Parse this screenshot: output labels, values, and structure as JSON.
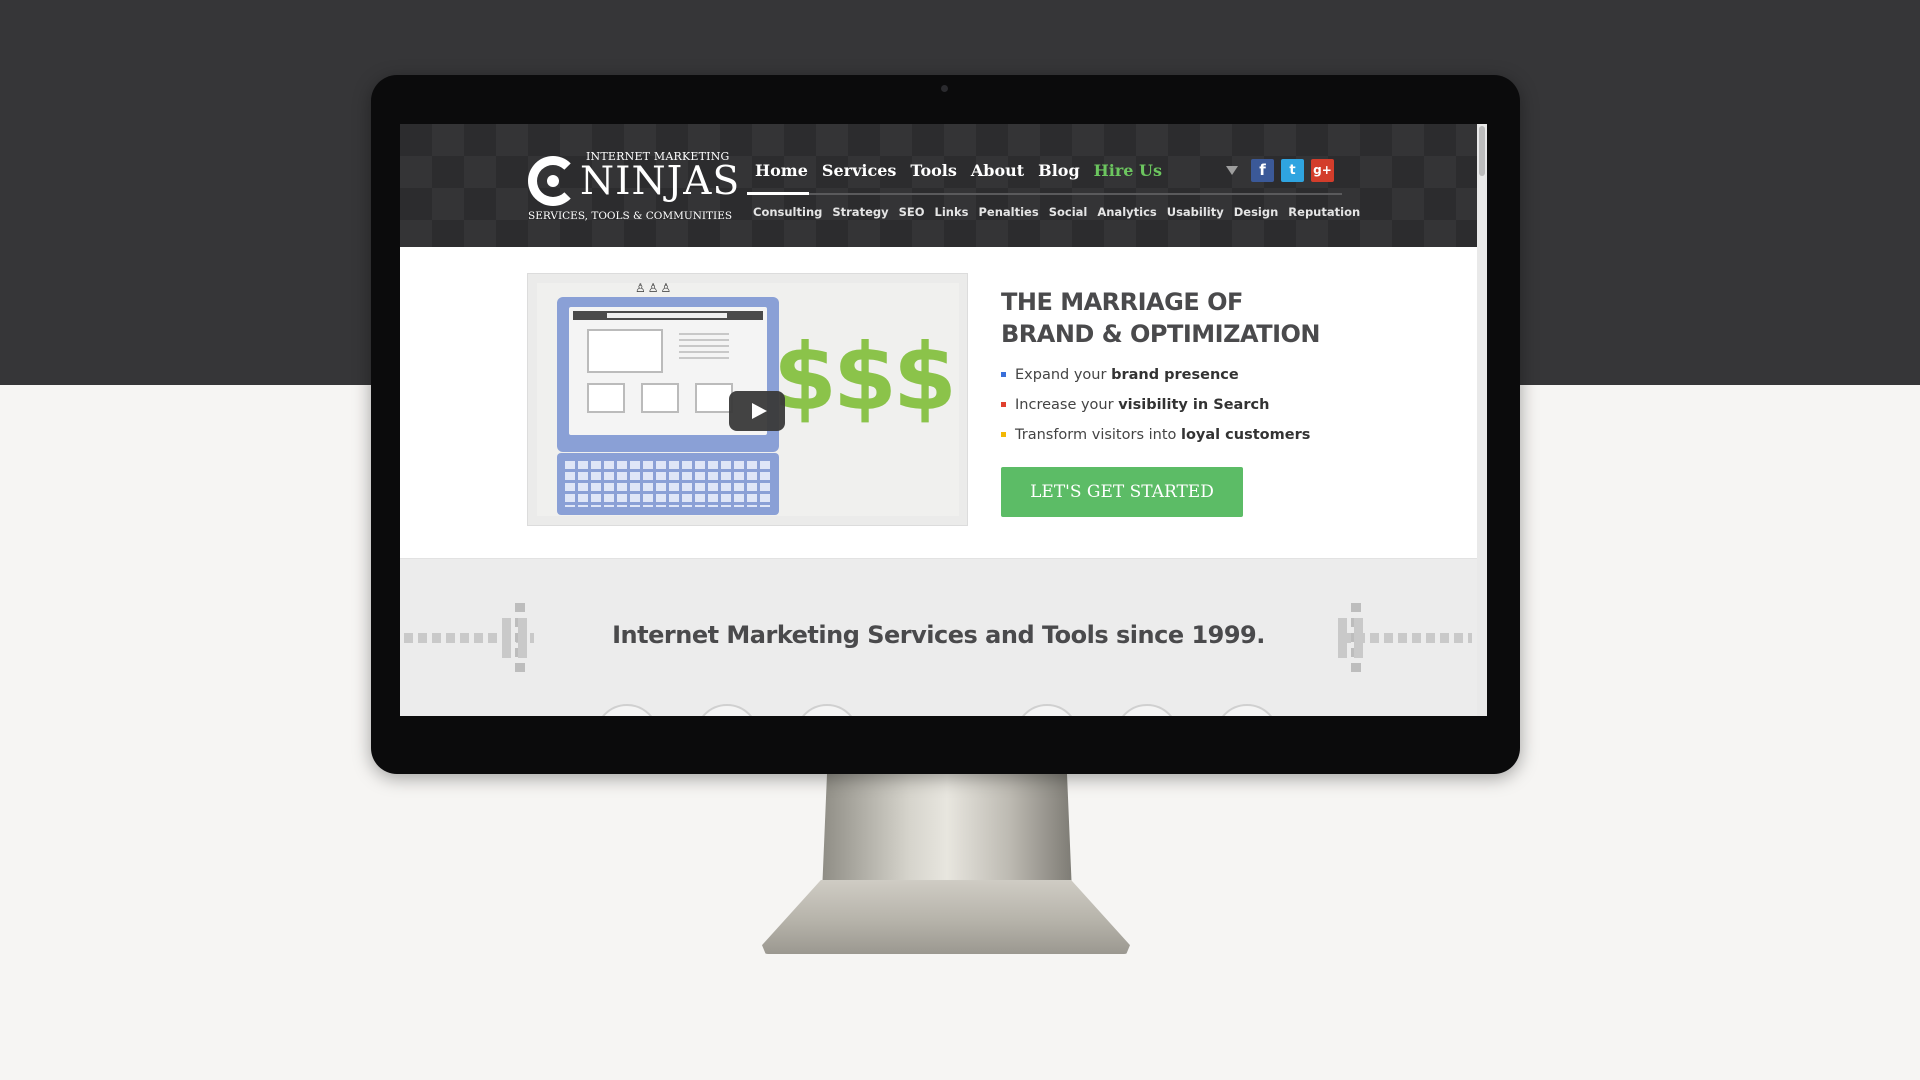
{
  "site": {
    "logo": {
      "top": "INTERNET MARKETING",
      "main": "NINJAS",
      "bottom": "SERVICES, TOOLS & COMMUNITIES"
    },
    "nav": [
      {
        "label": "Home"
      },
      {
        "label": "Services"
      },
      {
        "label": "Tools"
      },
      {
        "label": "About"
      },
      {
        "label": "Blog"
      },
      {
        "label": "Hire Us"
      }
    ],
    "subnav": [
      {
        "label": "Consulting"
      },
      {
        "label": "Strategy"
      },
      {
        "label": "SEO"
      },
      {
        "label": "Links"
      },
      {
        "label": "Penalties"
      },
      {
        "label": "Social"
      },
      {
        "label": "Analytics"
      },
      {
        "label": "Usability"
      },
      {
        "label": "Design"
      },
      {
        "label": "Reputation"
      }
    ],
    "social": {
      "facebook": "f",
      "twitter": "t",
      "googleplus": "g+"
    },
    "active_nav": "Home"
  },
  "hero": {
    "video": {
      "dollar_text": "$$$",
      "play_icon": "play-icon"
    },
    "title_line1": "THE MARRIAGE OF",
    "title_line2": "BRAND & OPTIMIZATION",
    "bullets": [
      {
        "pre": "Expand your ",
        "bold": "brand presence",
        "color": "#3a6fd8"
      },
      {
        "pre": "Increase your ",
        "bold": "visibility in Search",
        "color": "#e0402e"
      },
      {
        "pre": "Transform visitors into ",
        "bold": "loyal customers",
        "color": "#f2b705"
      }
    ],
    "cta": "LET'S GET STARTED"
  },
  "lower": {
    "heading": "Internet Marketing Services and Tools since 1999."
  },
  "colors": {
    "accent_green": "#5cbc66",
    "hire_green": "#6cc65f",
    "header_bg": "#2c2c2e",
    "page_dark": "#363638",
    "page_light": "#f6f5f3"
  }
}
